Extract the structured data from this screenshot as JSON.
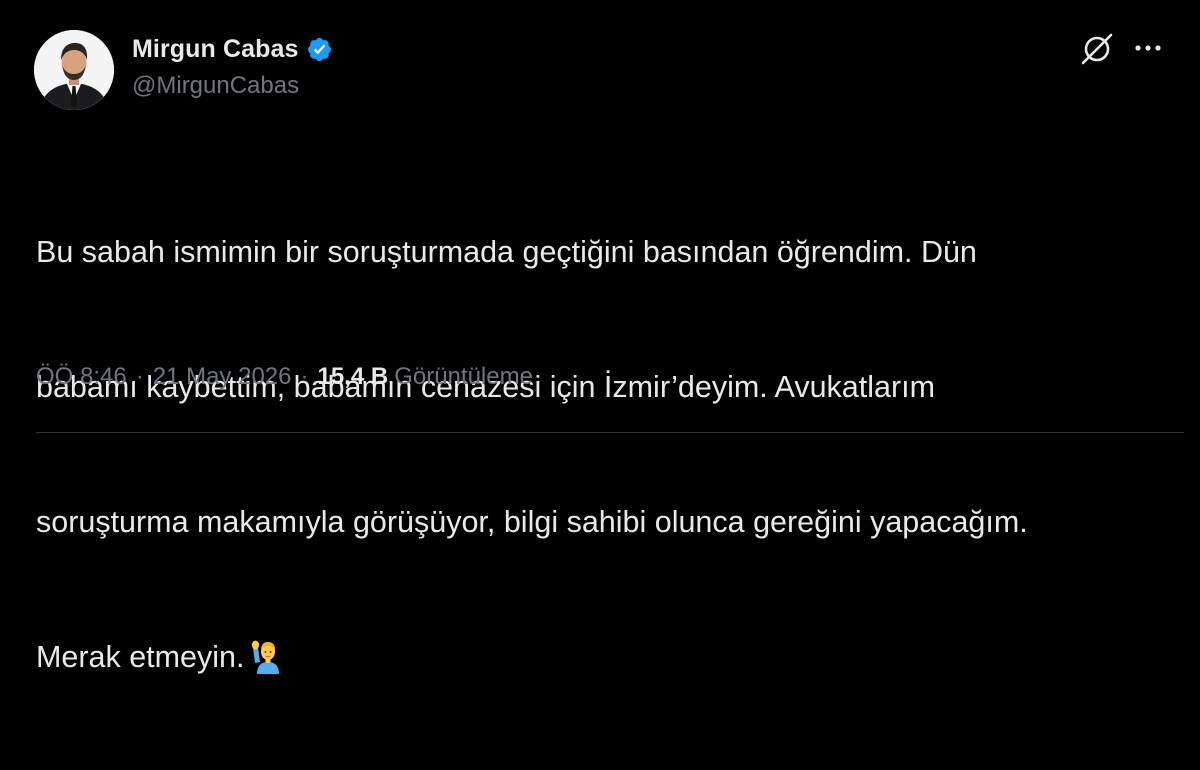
{
  "author": {
    "display_name": "Mirgun Cabas",
    "handle": "@MirgunCabas",
    "verified": true,
    "verified_color": "#1d9bf0"
  },
  "tweet": {
    "line1": "Bu sabah ismimin bir soruşturmada geçtiğini basından öğrendim. Dün",
    "line2": "babamı kaybettim, babamın cenazesi için İzmir’deyim. Avukatlarım",
    "line3": "soruşturma makamıyla görüşüyor, bilgi sahibi olunca gereğini yapacağım.",
    "line4": "Merak etmeyin.",
    "emoji": "person-raising-hand-emoji"
  },
  "meta": {
    "time": "ÖÖ 8:46",
    "date": "21 May 2026",
    "separator": "·",
    "views_count": "15,4 B",
    "views_label": "Görüntüleme"
  },
  "icons": {
    "grok": "grok-icon",
    "more": "more-icon"
  },
  "colors": {
    "background": "#000000",
    "text": "#e7e9ea",
    "secondary_text": "#71767b",
    "divider": "#2f3336"
  }
}
